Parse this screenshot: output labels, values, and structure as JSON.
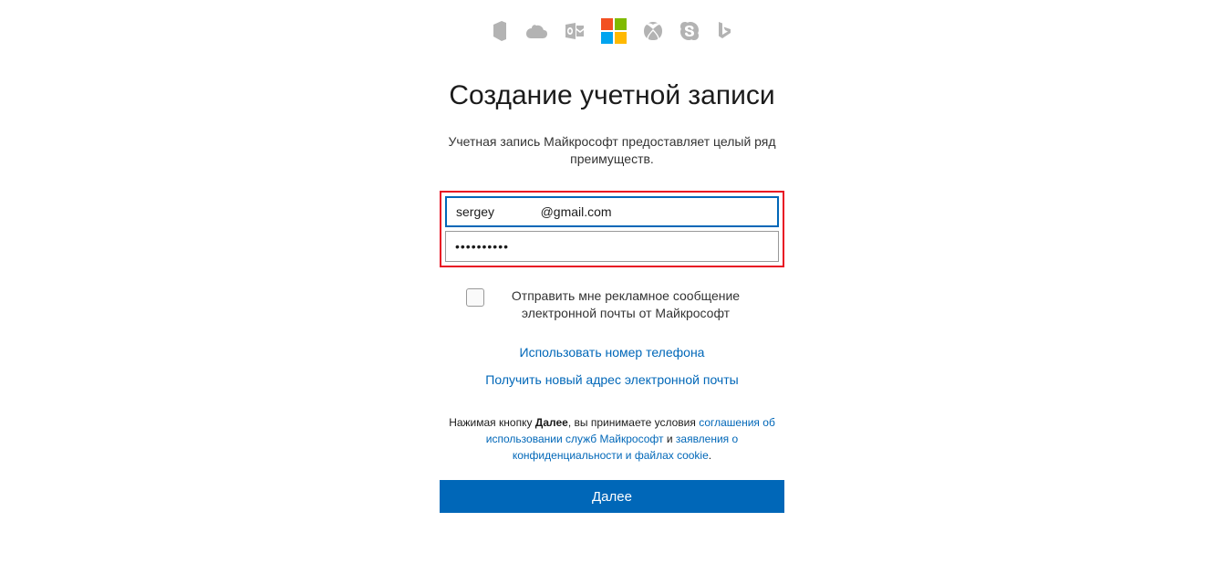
{
  "icons": {
    "office": "office-icon",
    "onedrive": "onedrive-icon",
    "outlook": "outlook-icon",
    "microsoft": "microsoft-logo-icon",
    "xbox": "xbox-icon",
    "skype": "skype-icon",
    "bing": "bing-icon"
  },
  "heading": "Создание учетной записи",
  "subheading": "Учетная запись Майкрософт предоставляет целый ряд преимуществ.",
  "form": {
    "email_value": "sergey             @gmail.com",
    "password_value": "••••••••••",
    "checkbox_label": "Отправить мне рекламное сообщение электронной почты от Майкрософт"
  },
  "links": {
    "use_phone": "Использовать номер телефона",
    "get_new_email": "Получить новый адрес электронной почты"
  },
  "terms": {
    "prefix": "Нажимая кнопку ",
    "button_name": "Далее",
    "mid1": ", вы принимаете условия ",
    "link1": "соглашения об использовании служб Майкрософт",
    "mid2": " и ",
    "link2": "заявления о конфиденциальности и файлах cookie",
    "suffix": "."
  },
  "button": {
    "next": "Далее"
  }
}
